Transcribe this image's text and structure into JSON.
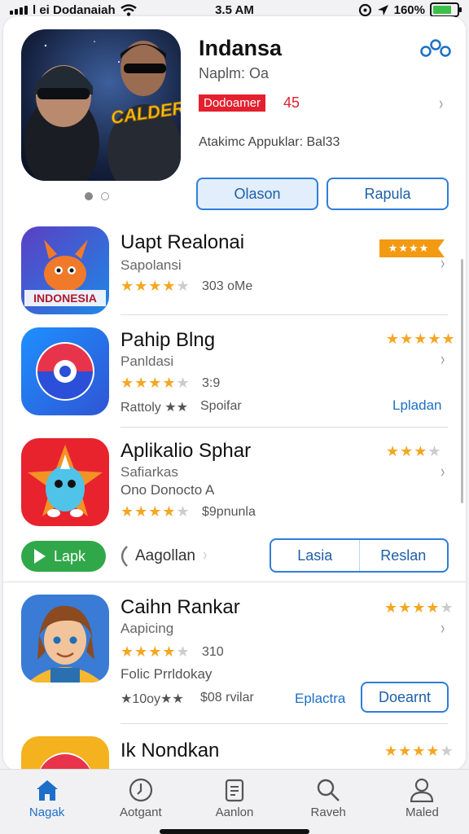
{
  "status": {
    "carrier": "l ei Dodanaiah",
    "time": "3.5 AM",
    "battery": "160%",
    "battery_level": 0.8
  },
  "featured": {
    "title": "Indansa",
    "subtitle": "Naplm: Oa",
    "badge": "Dodoamer",
    "badge_number": "45",
    "meta": "Atakimc Appuklar: Bal33",
    "art_text": "CALDERN",
    "buttons": [
      "Olason",
      "Rapula"
    ]
  },
  "apps": [
    {
      "title": "Uapt Realonai",
      "subtitle": "Sapolansi",
      "rating_text": "303 oMe",
      "badge_stars": "★★★★",
      "stars": 4,
      "icon_text": "INDONESIA"
    },
    {
      "title": "Pahip Blng",
      "subtitle": "Panldasi",
      "rating_text": "3:9",
      "extra_left": "Rattoly ★★",
      "extra_mid": "Spoifar",
      "action": "Lpladan",
      "stars": 4,
      "right_stars": 5
    },
    {
      "title": "Aplikalio Sphar",
      "subtitle": "Safiarkas",
      "extra": "Ono Donocto A",
      "rating_text": "$9pnunla",
      "stars": 4,
      "right_stars": 3
    },
    {
      "title": "Caihn Rankar",
      "subtitle": "Aapicing",
      "rating_text": "310",
      "extra": "Folic Prrldokay",
      "extra_left": "★10oy★★",
      "extra_mid": "$08 rvilar",
      "action_link": "Eplactra",
      "action_button": "Doearnt",
      "stars": 4,
      "right_stars": 4
    },
    {
      "title": "Ik Nondkan",
      "right_stars": 4
    }
  ],
  "action_row": {
    "green": "Lapk",
    "link": "Aagollan",
    "segments": [
      "Lasia",
      "Reslan"
    ]
  },
  "tabs": [
    {
      "label": "Nagak",
      "icon": "home-icon",
      "active": true
    },
    {
      "label": "Aotgant",
      "icon": "clock-icon"
    },
    {
      "label": "Aanlon",
      "icon": "document-icon"
    },
    {
      "label": "Raveh",
      "icon": "search-icon"
    },
    {
      "label": "Maled",
      "icon": "profile-icon"
    }
  ],
  "colors": {
    "accent": "#1d6fc8",
    "star": "#f5a623",
    "red": "#e4202f",
    "green": "#30a84a"
  }
}
